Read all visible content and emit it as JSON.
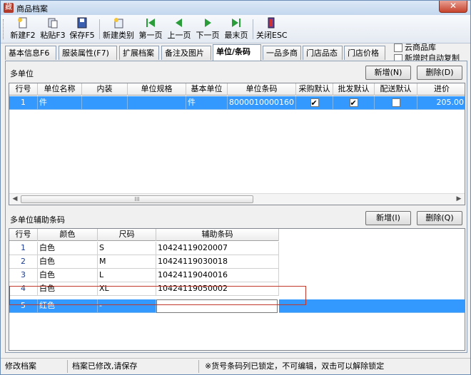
{
  "window": {
    "title": "商品档案",
    "close_label": "✕"
  },
  "toolbar": {
    "buttons": [
      {
        "label": "新建F2"
      },
      {
        "label": "粘贴F3"
      },
      {
        "label": "保存F5"
      },
      {
        "label": "新建类别"
      },
      {
        "label": "第一页"
      },
      {
        "label": "上一页"
      },
      {
        "label": "下一页"
      },
      {
        "label": "最末页"
      },
      {
        "label": "关闭ESC"
      }
    ]
  },
  "tabs": [
    {
      "label": "基本信息F6"
    },
    {
      "label": "服装属性(F7)"
    },
    {
      "label": "扩展档案"
    },
    {
      "label": "备注及图片"
    },
    {
      "label": "单位/条码"
    },
    {
      "label": "一品多商"
    },
    {
      "label": "门店品态"
    },
    {
      "label": "门店价格"
    }
  ],
  "options": {
    "cloud_library": {
      "label": "云商品库",
      "checked": false
    },
    "auto_copy": {
      "label": "新增时自动复制",
      "checked": false
    }
  },
  "multi_unit": {
    "title": "多单位",
    "add_label": "新增(N)",
    "delete_label": "删除(D)",
    "columns": [
      "行号",
      "单位名称",
      "内装",
      "单位规格",
      "基本单位",
      "单位条码",
      "采购默认",
      "批发默认",
      "配送默认",
      "进价"
    ],
    "rows": [
      {
        "row": "1",
        "unit_name": "件",
        "inner": "",
        "spec": "",
        "base_unit": "件",
        "barcode": "8000010000160",
        "purchase_default": true,
        "wholesale_default": true,
        "delivery_default": false,
        "cost": "205.00"
      }
    ],
    "scroll_label": "III"
  },
  "aux_barcode": {
    "title": "多单位辅助条码",
    "add_label": "新增(I)",
    "delete_label": "删除(Q)",
    "columns": [
      "行号",
      "颜色",
      "尺码",
      "辅助条码"
    ],
    "rows": [
      {
        "row": "1",
        "color": "白色",
        "size": "S",
        "barcode": "10424119020007"
      },
      {
        "row": "2",
        "color": "白色",
        "size": "M",
        "barcode": "10424119030018"
      },
      {
        "row": "3",
        "color": "白色",
        "size": "L",
        "barcode": "10424119040016"
      },
      {
        "row": "4",
        "color": "白色",
        "size": "XL",
        "barcode": "10424119050002"
      },
      {
        "row": "5",
        "color": "红色",
        "size": "-",
        "barcode": ""
      }
    ]
  },
  "status": {
    "mode": "修改档案",
    "message": "档案已修改,请保存",
    "hint": "※货号条码列已锁定，不可编辑，双击可以解除锁定"
  },
  "colors": {
    "selection": "#3399ff",
    "highlight_box": "#c0392b"
  }
}
